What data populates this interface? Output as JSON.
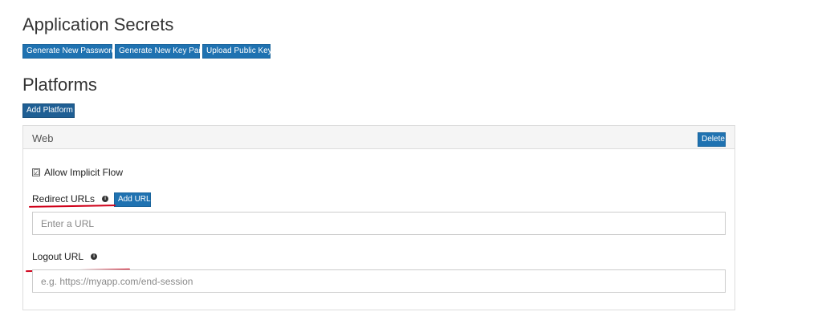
{
  "secrets": {
    "title": "Application Secrets",
    "buttons": {
      "generate_password": "Generate New Password",
      "generate_key_pair": "Generate New Key Pair",
      "upload_public_key": "Upload Public Key"
    }
  },
  "platforms": {
    "title": "Platforms",
    "add_platform_label": "Add Platform",
    "web_panel": {
      "title": "Web",
      "delete_label": "Delete",
      "implicit_flow": {
        "label": "Allow Implicit Flow",
        "checked": true,
        "check_glyph": "☑"
      },
      "redirect": {
        "label": "Redirect URLs",
        "info_icon": "i",
        "add_url_label": "Add URL",
        "placeholder": "Enter a URL",
        "value": ""
      },
      "logout": {
        "label": "Logout URL",
        "info_icon": "i",
        "placeholder": "e.g. https://myapp.com/end-session",
        "value": ""
      }
    }
  },
  "colors": {
    "button_blue": "#1f72b1",
    "annotation_red": "#d0021b"
  }
}
